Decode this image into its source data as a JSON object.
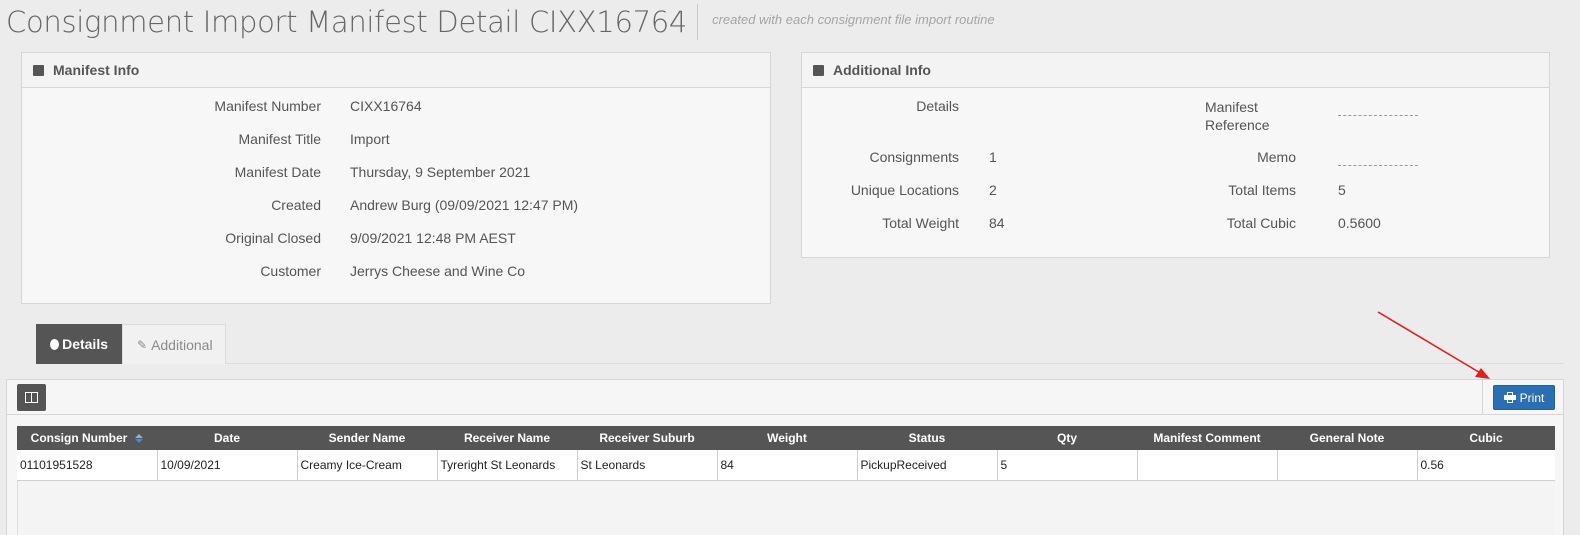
{
  "page": {
    "title": "Consignment Import Manifest Detail CIXX16764",
    "subtitle": "created with each consignment file import routine"
  },
  "manifest_info": {
    "title": "Manifest Info",
    "fields": [
      {
        "label": "Manifest Number",
        "value": "CIXX16764"
      },
      {
        "label": "Manifest Title",
        "value": "Import"
      },
      {
        "label": "Manifest Date",
        "value": "Thursday, 9 September 2021"
      },
      {
        "label": "Created",
        "value": "Andrew Burg (09/09/2021 12:47 PM)"
      },
      {
        "label": "Original Closed",
        "value": "9/09/2021 12:48 PM AEST"
      },
      {
        "label": "Customer",
        "value": "Jerrys Cheese and Wine Co"
      }
    ]
  },
  "additional_info": {
    "title": "Additional Info",
    "left": [
      {
        "label": "Details",
        "value": ""
      },
      {
        "label": "Consignments",
        "value": "1"
      },
      {
        "label": "Unique Locations",
        "value": "2"
      },
      {
        "label": "Total Weight",
        "value": "84"
      }
    ],
    "right": [
      {
        "label_line1": "Manifest",
        "label_line2": "Reference",
        "value": ""
      },
      {
        "label": "Memo",
        "value": ""
      },
      {
        "label": "Total Items",
        "value": "5"
      },
      {
        "label": "Total Cubic",
        "value": "0.5600"
      }
    ]
  },
  "tabs": [
    {
      "label": "Details",
      "icon": "circle-icon",
      "active": true
    },
    {
      "label": "Additional",
      "icon": "pencil-icon",
      "active": false
    }
  ],
  "toolbar": {
    "print_label": "Print",
    "column_toggle_icon": "columns-icon"
  },
  "grid": {
    "headers": [
      "Consign Number",
      "Date",
      "Sender Name",
      "Receiver Name",
      "Receiver Suburb",
      "Weight",
      "Status",
      "Qty",
      "Manifest Comment",
      "General Note",
      "Cubic"
    ],
    "rows": [
      [
        "01101951528",
        "10/09/2021",
        "Creamy Ice-Cream",
        "Tyreright St Leonards",
        "St Leonards",
        "84",
        "PickupReceived",
        "5",
        "",
        "",
        "0.56"
      ]
    ],
    "sorted_column": "Consign Number"
  },
  "colors": {
    "header_bg": "#555555",
    "print_button": "#2a6fb3",
    "annotation_arrow": "#e02020"
  }
}
